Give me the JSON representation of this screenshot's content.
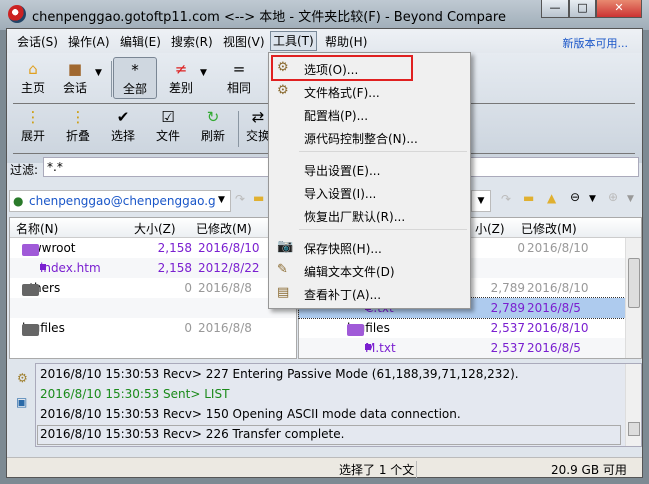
{
  "title": "chenpenggao.gotoftp11.com <--> 本地 - 文件夹比较(F) - Beyond Compare",
  "window_buttons": {
    "minimize": "—",
    "maximize": "□",
    "close": "✕"
  },
  "menu": [
    "会话(S)",
    "操作(A)",
    "编辑(E)",
    "搜索(R)",
    "视图(V)",
    "工具(T)",
    "帮助(H)"
  ],
  "new_version": "新版本可用...",
  "toolbar1": [
    {
      "label": "主页",
      "icon": "⌂"
    },
    {
      "label": "会话",
      "icon": "■"
    },
    {
      "label": "全部",
      "icon": "*"
    },
    {
      "label": "差别",
      "icon": "≠"
    },
    {
      "label": "相同",
      "icon": "="
    }
  ],
  "toolbar2": [
    {
      "label": "展开",
      "icon": "⋮"
    },
    {
      "label": "折叠",
      "icon": "⋮"
    },
    {
      "label": "选择",
      "icon": "✔"
    },
    {
      "label": "文件",
      "icon": "☑"
    },
    {
      "label": "刷新",
      "icon": "↻"
    },
    {
      "label": "交换",
      "icon": "⇄"
    }
  ],
  "filter": {
    "label": "过滤:",
    "value": "*.*"
  },
  "left_path": "chenpenggao@chenpenggao.g",
  "columns": {
    "name": "名称(N)",
    "size": "大小(Z)",
    "modified": "已修改(M)"
  },
  "right_columns": {
    "size": "小(Z)",
    "modified": "已修改(M)"
  },
  "left_rows": [
    {
      "name": "wwwroot",
      "size": "2,158",
      "date": "2016/8/10",
      "type": "folder",
      "diff": true
    },
    {
      "name": "index.htm",
      "size": "2,158",
      "date": "2012/8/22",
      "type": "file",
      "diff": true
    },
    {
      "name": "others",
      "size": "0",
      "date": "2016/8/8",
      "type": "folder",
      "diff": false
    },
    {
      "name": "",
      "size": "",
      "date": "",
      "type": "empty",
      "diff": false
    },
    {
      "name": "logfiles",
      "size": "0",
      "date": "2016/8/8",
      "type": "folder",
      "diff": false
    }
  ],
  "right_rows": [
    {
      "name": "",
      "size": "0",
      "date": "2016/8/10",
      "type": "folder",
      "diff": false
    },
    {
      "name": "",
      "size": "",
      "date": "",
      "type": "empty",
      "diff": false
    },
    {
      "name": "",
      "size": "2,789",
      "date": "2016/8/10",
      "type": "folder",
      "diff": false
    },
    {
      "name": "C.txt",
      "size": "2,789",
      "date": "2016/8/5",
      "type": "file",
      "diff": true,
      "selected": true
    },
    {
      "name": "logfiles",
      "size": "2,537",
      "date": "2016/8/10",
      "type": "folder",
      "diff": true
    },
    {
      "name": "M.txt",
      "size": "2,537",
      "date": "2016/8/5",
      "type": "file",
      "diff": true
    }
  ],
  "tools_menu": [
    {
      "label": "选项(O)...",
      "icon": "⚙",
      "highlight": true
    },
    {
      "label": "文件格式(F)...",
      "icon": "⚙"
    },
    {
      "label": "配置档(P)...",
      "icon": ""
    },
    {
      "label": "源代码控制整合(N)...",
      "icon": ""
    },
    {
      "label": "导出设置(E)...",
      "icon": ""
    },
    {
      "label": "导入设置(I)...",
      "icon": ""
    },
    {
      "label": "恢复出厂默认(R)...",
      "icon": ""
    },
    {
      "label": "保存快照(H)...",
      "icon": "📷"
    },
    {
      "label": "编辑文本文件(D)",
      "icon": "✎"
    },
    {
      "label": "查看补丁(A)...",
      "icon": "▤"
    }
  ],
  "log": [
    {
      "text": "2016/8/10 15:30:53  Recv> 227 Entering Passive Mode (61,188,39,71,128,232).",
      "color": "#000"
    },
    {
      "text": "2016/8/10 15:30:53  Sent> LIST",
      "color": "#1a8a1a"
    },
    {
      "text": "2016/8/10 15:30:53  Recv> 150 Opening ASCII mode data connection.",
      "color": "#000"
    },
    {
      "text": "2016/8/10 15:30:53  Recv> 226 Transfer complete.",
      "color": "#000"
    }
  ],
  "status": {
    "selection": "选择了 1 个文",
    "free": "20.9 GB 可用"
  },
  "colors": {
    "highlight_box": "#e02020",
    "selected_row": "#aecbee",
    "diff": "#7a1fd0"
  }
}
